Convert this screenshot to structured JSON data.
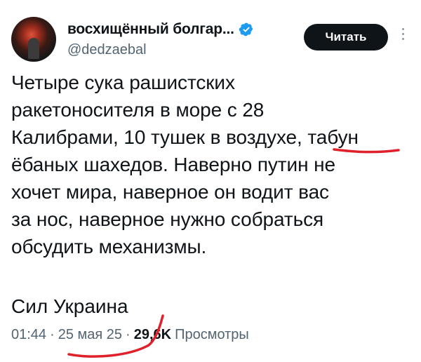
{
  "author": {
    "display_name": "восхищённый болгар...",
    "handle": "@dedzaebal"
  },
  "follow_button_label": "Читать",
  "tweet": {
    "lines": [
      "Четыре сука рашистских",
      "ракетоносителя в море с 28",
      "Калибрами, 10 тушек в воздухе, табун",
      "ёбаных шахедов. Наверно путин не",
      "хочет мира, наверное он водит вас",
      "за нос, наверное нужно собраться",
      "обсудить механизмы."
    ],
    "signature": "Сил Украина"
  },
  "meta": {
    "time": "01:44",
    "separator": "·",
    "date": "25 мая 25",
    "views_count": "29,6K",
    "views_label": "Просмотры"
  },
  "colors": {
    "verified_badge": "#1d9bf0",
    "annotation_ink": "#e0202a",
    "secondary_text": "#536471"
  }
}
